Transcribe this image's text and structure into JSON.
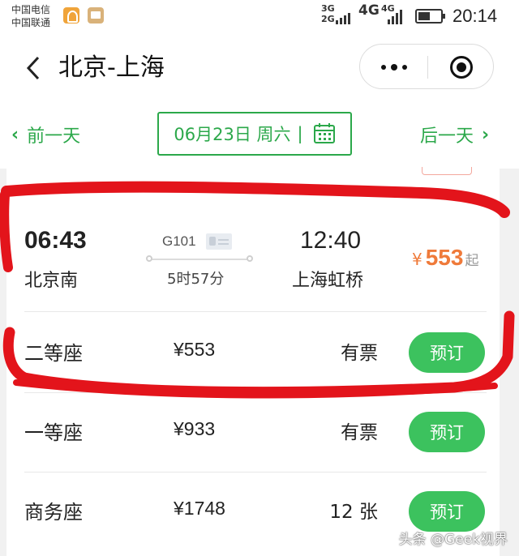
{
  "status_bar": {
    "carrier_1": "中国电信",
    "carrier_2": "中国联通",
    "net_a_top": "3G",
    "net_a_bottom": "2G",
    "net_b": "4G",
    "net_c": "4G",
    "time": "20:14"
  },
  "nav": {
    "title": "北京-上海",
    "back_icon": "chevron-left-icon",
    "more_icon": "more-dots-icon",
    "close_icon": "target-close-icon"
  },
  "date_bar": {
    "prev_label": "前一天",
    "date_label": "06月23日 周六",
    "separator": "|",
    "next_label": "后一天",
    "accent_color": "#2ba84a"
  },
  "train": {
    "departure_time": "06:43",
    "departure_station": "北京南",
    "train_number": "G101",
    "duration": "5时57分",
    "arrival_time": "12:40",
    "arrival_station": "上海虹桥",
    "price_currency": "¥",
    "price_amount": "553",
    "price_suffix": "起",
    "price_color": "#ef7a3a"
  },
  "seats": [
    {
      "name": "二等座",
      "price": "¥553",
      "availability": "有票",
      "button": "预订"
    },
    {
      "name": "一等座",
      "price": "¥933",
      "availability": "有票",
      "button": "预订"
    },
    {
      "name": "商务座",
      "price": "¥1748",
      "availability": "12 张",
      "button": "预订"
    }
  ],
  "button_color": "#3cc25e",
  "annotation_color": "#e3141b",
  "watermark": "头条 @Geek视界"
}
